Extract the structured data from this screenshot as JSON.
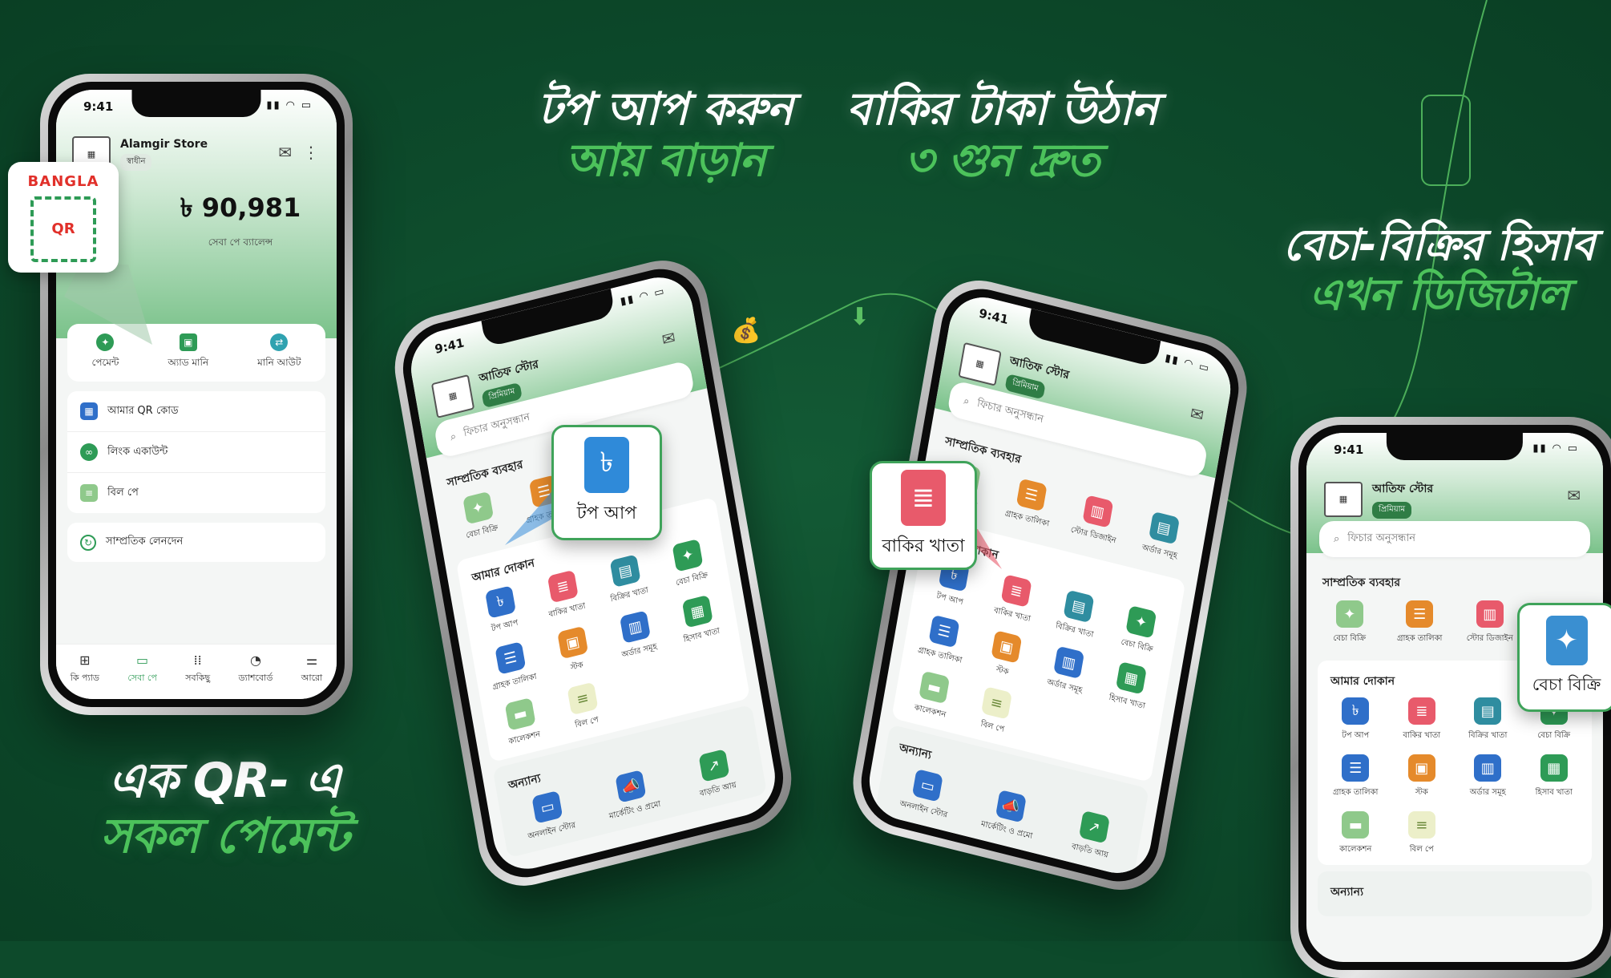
{
  "headlines": {
    "topup": {
      "line1": "টপ আপ করুন",
      "line2": "আয় বাড়ান"
    },
    "baki": {
      "line1": "বাকির টাকা উঠান",
      "line2": "৩ গুন দ্রুত"
    },
    "becha": {
      "line1": "বেচা-বিক্রির হিসাব",
      "line2": "এখন ডিজিটাল"
    },
    "qr": {
      "line1": "এক QR- এ",
      "line2": "সকল পেমেন্ট"
    }
  },
  "phone1": {
    "time": "9:41",
    "store_name": "Alamgir Store",
    "badge": "স্বাধীন",
    "balance": "৳ 90,981",
    "balance_label": "সেবা পে ব্যালেন্স",
    "qr_brand": "BANGLA",
    "qr_text": "QR",
    "quick_actions": [
      {
        "label": "পেমেন্ট",
        "icon": "payment-icon"
      },
      {
        "label": "অ্যাড মানি",
        "icon": "add-money-icon"
      },
      {
        "label": "মানি আউট",
        "icon": "money-out-icon"
      }
    ],
    "list": [
      {
        "label": "আমার QR কোড",
        "icon": "qr-code-icon"
      },
      {
        "label": "লিংক একাউন্ট",
        "icon": "link-icon"
      },
      {
        "label": "বিল পে",
        "icon": "bill-icon"
      }
    ],
    "recent": "সাম্প্রতিক লেনদেন",
    "nav": [
      {
        "label": "কি প্যাড",
        "icon": "keypad-icon"
      },
      {
        "label": "সেবা পে",
        "icon": "wallet-icon"
      },
      {
        "label": "সবকিছু",
        "icon": "grid-icon"
      },
      {
        "label": "ড্যাশবোর্ড",
        "icon": "dashboard-icon"
      },
      {
        "label": "আরো",
        "icon": "more-icon"
      }
    ]
  },
  "shop": {
    "time": "9:41",
    "store_name": "আতিফ স্টোর",
    "badge": "প্রিমিয়াম",
    "search_placeholder": "ফিচার অনুসন্ধান",
    "recent_title": "সাম্প্রতিক ব্যবহার",
    "recent": [
      {
        "label": "বেচা বিক্রি",
        "icon": "sell-icon"
      },
      {
        "label": "গ্রাহক তালিকা",
        "icon": "customer-list-icon"
      },
      {
        "label": "স্টোর ডিজাইন",
        "icon": "store-design-icon"
      },
      {
        "label": "অর্ডার সমূহ",
        "icon": "orders-icon"
      }
    ],
    "my_shop_title": "আমার দোকান",
    "my_shop": [
      {
        "label": "টপ আপ",
        "icon": "topup-icon",
        "color": "blue"
      },
      {
        "label": "বাকির খাতা",
        "icon": "baki-khata-icon",
        "color": "red"
      },
      {
        "label": "বিক্রির খাতা",
        "icon": "sales-book-icon",
        "color": "teal"
      },
      {
        "label": "বেচা বিক্রি",
        "icon": "sell-icon",
        "color": "green"
      },
      {
        "label": "গ্রাহক তালিকা",
        "icon": "customer-list-icon",
        "color": "blue"
      },
      {
        "label": "স্টক",
        "icon": "stock-icon",
        "color": "orange"
      },
      {
        "label": "অর্ডার সমূহ",
        "icon": "orders-icon",
        "color": "blue"
      },
      {
        "label": "হিসাব খাতা",
        "icon": "accounts-icon",
        "color": "green"
      },
      {
        "label": "কালেকশন",
        "icon": "collection-icon",
        "color": "lgreen"
      },
      {
        "label": "বিল পে",
        "icon": "bill-icon",
        "color": "cream"
      }
    ],
    "others_title": "অন্যান্য",
    "others": [
      {
        "label": "অনলাইন স্টোর",
        "icon": "online-store-icon"
      },
      {
        "label": "মার্কেটিং ও প্রমো",
        "icon": "megaphone-icon"
      },
      {
        "label": "বাড়তি আয়",
        "icon": "extra-income-icon"
      }
    ]
  },
  "callouts": {
    "topup": "টপ আপ",
    "baki": "বাকির খাতা",
    "becha": "বেচা বিক্রি"
  },
  "colors": {
    "background": "#0d4a2b",
    "accent_green": "#4cc25b",
    "brand_green": "#2e9b56"
  }
}
